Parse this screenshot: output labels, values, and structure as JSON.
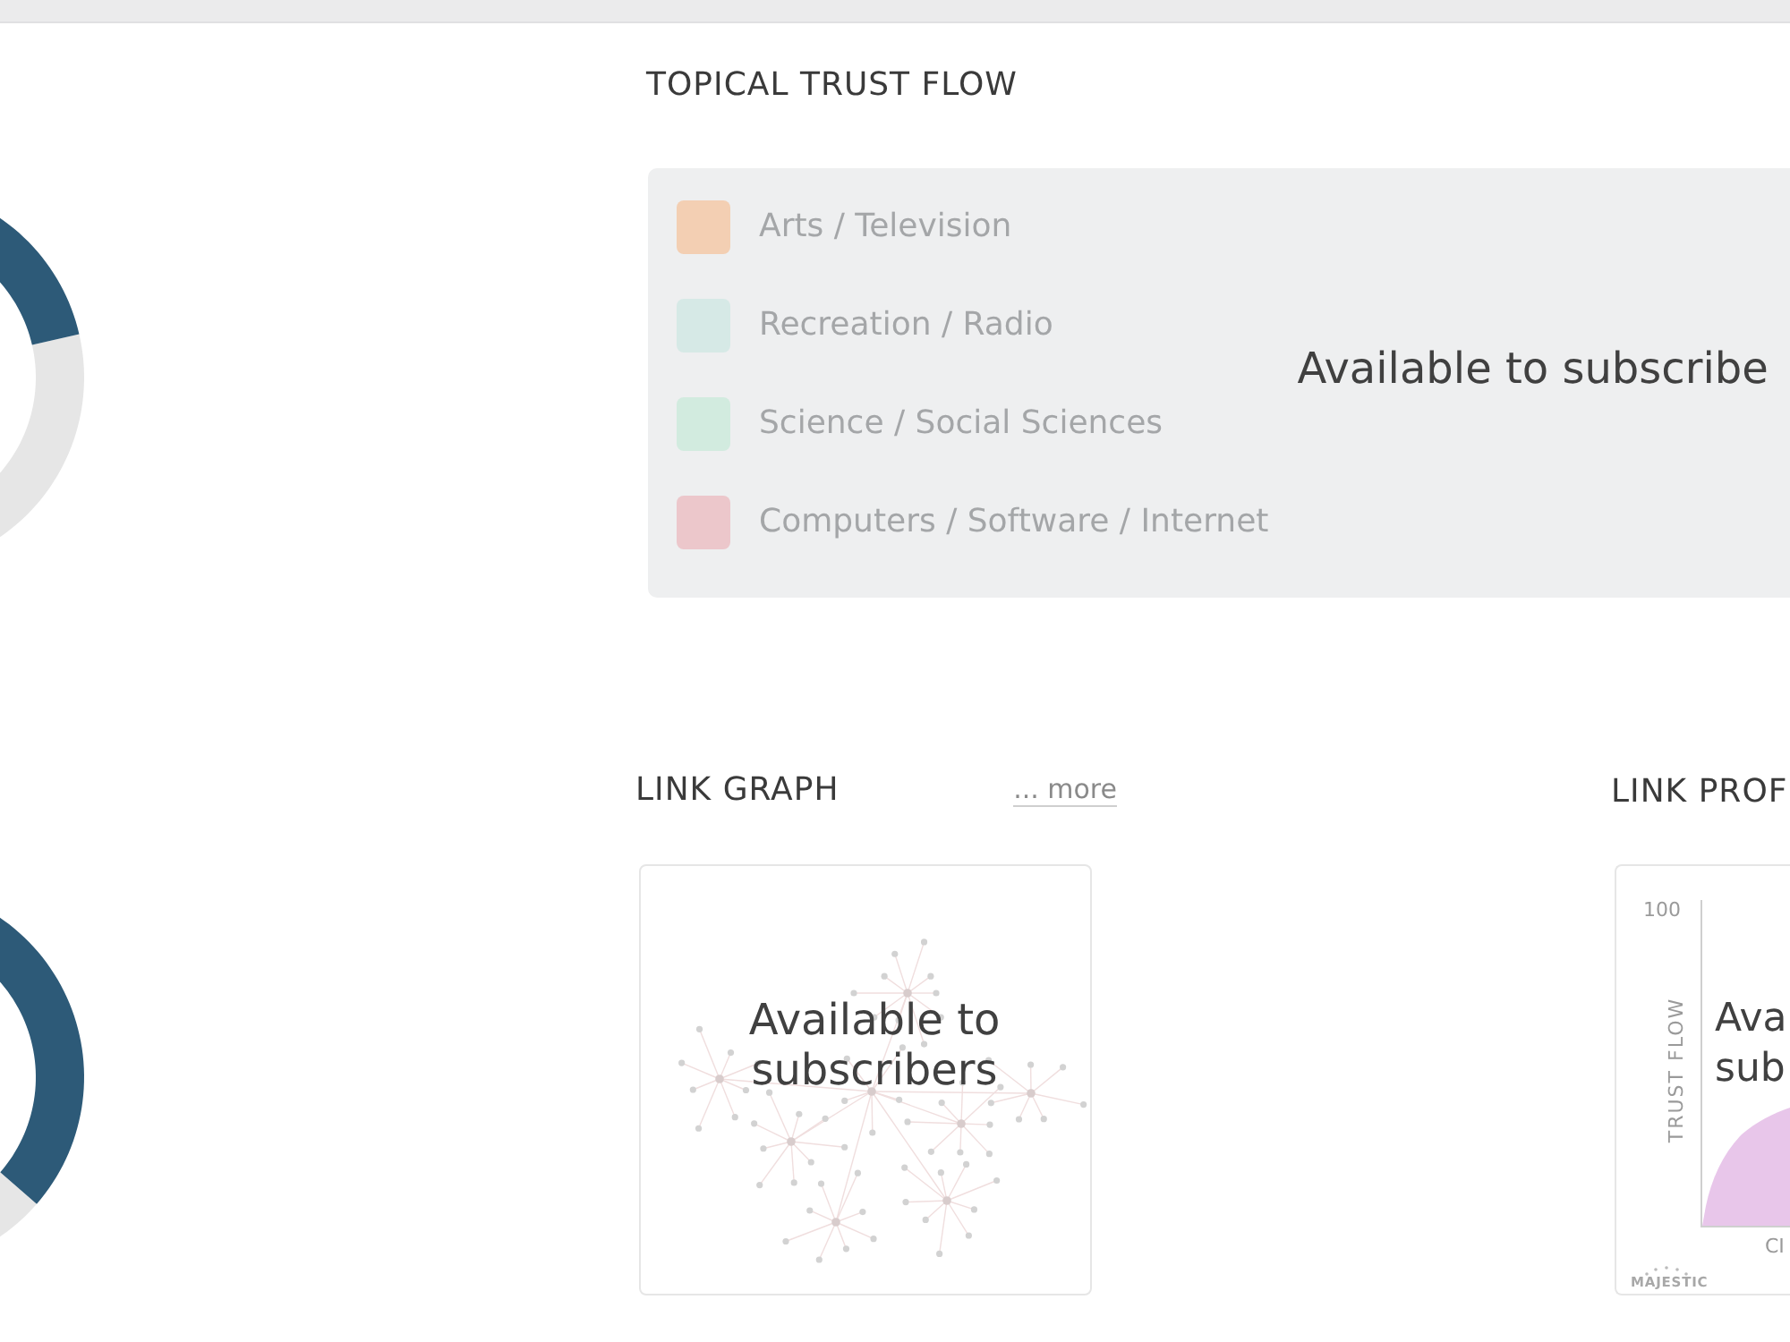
{
  "topical_trust_flow": {
    "title": "TOPICAL TRUST FLOW",
    "categories": [
      {
        "label": "Arts / Television",
        "color": "#f3cfb3"
      },
      {
        "label": "Recreation / Radio",
        "color": "#d6e9e6"
      },
      {
        "label": "Science / Social Sciences",
        "color": "#d2ebdf"
      },
      {
        "label": "Computers / Software / Internet",
        "color": "#ecc7cb"
      }
    ],
    "overlay": "Available to subscribe"
  },
  "link_graph": {
    "title": "LINK GRAPH",
    "more_link": "... more",
    "overlay": "Available to subscribers"
  },
  "link_profile": {
    "title": "LINK PROF",
    "y_tick": "100",
    "y_label": "TRUST FLOW",
    "x_label": "CI",
    "logo": "MAJESTIC",
    "overlay_lines": [
      "Ava",
      "sub"
    ]
  }
}
